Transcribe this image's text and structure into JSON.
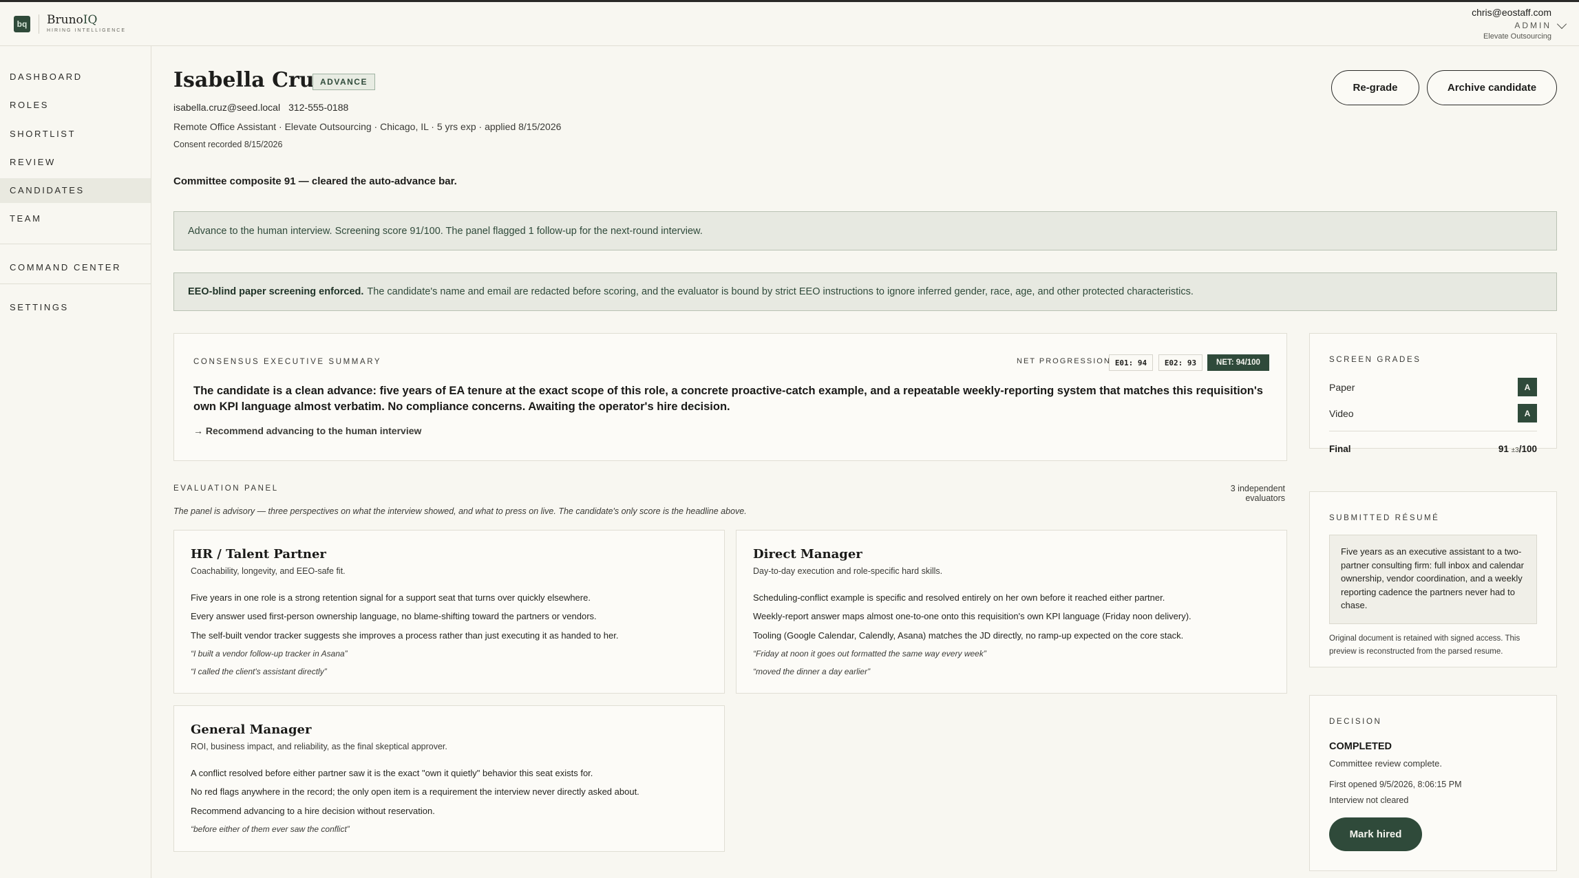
{
  "brand": {
    "logo_text": "bq",
    "name_main": "Bruno",
    "name_accent": "IQ",
    "tagline": "HIRING INTELLIGENCE"
  },
  "account": {
    "email": "chris@eostaff.com",
    "role": "ADMIN",
    "org": "Elevate Outsourcing"
  },
  "nav": {
    "dashboard": "DASHBOARD",
    "roles": "ROLES",
    "shortlist": "SHORTLIST",
    "review": "REVIEW",
    "candidates": "CANDIDATES",
    "team": "TEAM",
    "command_center": "COMMAND CENTER",
    "settings": "SETTINGS",
    "active": "candidates"
  },
  "candidate": {
    "name": "Isabella Cruz",
    "badge": "ADVANCE",
    "email": "isabella.cruz@seed.local",
    "phone": "312-555-0188",
    "meta": "Remote Office Assistant · Elevate Outsourcing · Chicago, IL · 5 yrs exp · applied 8/15/2026",
    "consent": "Consent recorded 8/15/2026"
  },
  "actions": {
    "regrade": "Re-grade",
    "archive": "Archive candidate"
  },
  "composite": "Committee composite 91 — cleared the auto-advance bar.",
  "advance_banner": "Advance to the human interview. Screening score 91/100. The panel flagged 1 follow-up for the next-round interview.",
  "eeo_banner": {
    "bold": "EEO-blind paper screening enforced.",
    "text": "The candidate's name and email are redacted before scoring, and the evaluator is bound by strict EEO instructions to ignore inferred gender, race, age, and other protected characteristics."
  },
  "consensus": {
    "label": "CONSENSUS EXECUTIVE SUMMARY",
    "net_label": "NET PROGRESSION:",
    "e01": "E01: 94",
    "e02": "E02: 93",
    "net": "NET: 94/100",
    "text": "The candidate is a clean advance: five years of EA tenure at the exact scope of this role, a concrete proactive-catch example, and a repeatable weekly-reporting system that matches this requisition's own KPI language almost verbatim. No compliance concerns. Awaiting the operator's hire decision.",
    "recommendation": "→ Recommend advancing to the human interview"
  },
  "panel": {
    "label": "EVALUATION PANEL",
    "count": "3 independent evaluators",
    "note": "The panel is advisory — three perspectives on what the interview showed, and what to press on live. The candidate's only score is the headline above.",
    "evaluators": [
      {
        "title": "HR / Talent Partner",
        "subtitle": "Coachability, longevity, and EEO-safe fit.",
        "lines": [
          "Five years in one role is a strong retention signal for a support seat that turns over quickly elsewhere.",
          "Every answer used first-person ownership language, no blame-shifting toward the partners or vendors.",
          "The self-built vendor tracker suggests she improves a process rather than just executing it as handed to her."
        ],
        "quotes": [
          "“I built a vendor follow-up tracker in Asana”",
          "“I called the client's assistant directly”"
        ]
      },
      {
        "title": "Direct Manager",
        "subtitle": "Day-to-day execution and role-specific hard skills.",
        "lines": [
          "Scheduling-conflict example is specific and resolved entirely on her own before it reached either partner.",
          "Weekly-report answer maps almost one-to-one onto this requisition's own KPI language (Friday noon delivery).",
          "Tooling (Google Calendar, Calendly, Asana) matches the JD directly, no ramp-up expected on the core stack."
        ],
        "quotes": [
          "“Friday at noon it goes out formatted the same way every week”",
          "“moved the dinner a day earlier”"
        ]
      },
      {
        "title": "General Manager",
        "subtitle": "ROI, business impact, and reliability, as the final skeptical approver.",
        "lines": [
          "A conflict resolved before either partner saw it is the exact \"own it quietly\" behavior this seat exists for.",
          "No red flags anywhere in the record; the only open item is a requirement the interview never directly asked about.",
          "Recommend advancing to a hire decision without reservation."
        ],
        "quotes": [
          "“before either of them ever saw the conflict”"
        ]
      }
    ]
  },
  "grades": {
    "label": "SCREEN GRADES",
    "paper_label": "Paper",
    "paper": "A",
    "video_label": "Video",
    "video": "A",
    "final_label": "Final",
    "final_score": "91",
    "final_margin": "±3",
    "final_max": "/100"
  },
  "resume": {
    "label": "SUBMITTED RÉSUMÉ",
    "text": "Five years as an executive assistant to a two-partner consulting firm: full inbox and calendar ownership, vendor coordination, and a weekly reporting cadence the partners never had to chase.",
    "note": "Original document is retained with signed access. This preview is reconstructed from the parsed resume."
  },
  "decision": {
    "label": "DECISION",
    "status": "COMPLETED",
    "subtitle": "Committee review complete.",
    "first_opened": "First opened 9/5/2026, 8:06:15 PM",
    "interview": "Interview not cleared",
    "button": "Mark hired"
  }
}
